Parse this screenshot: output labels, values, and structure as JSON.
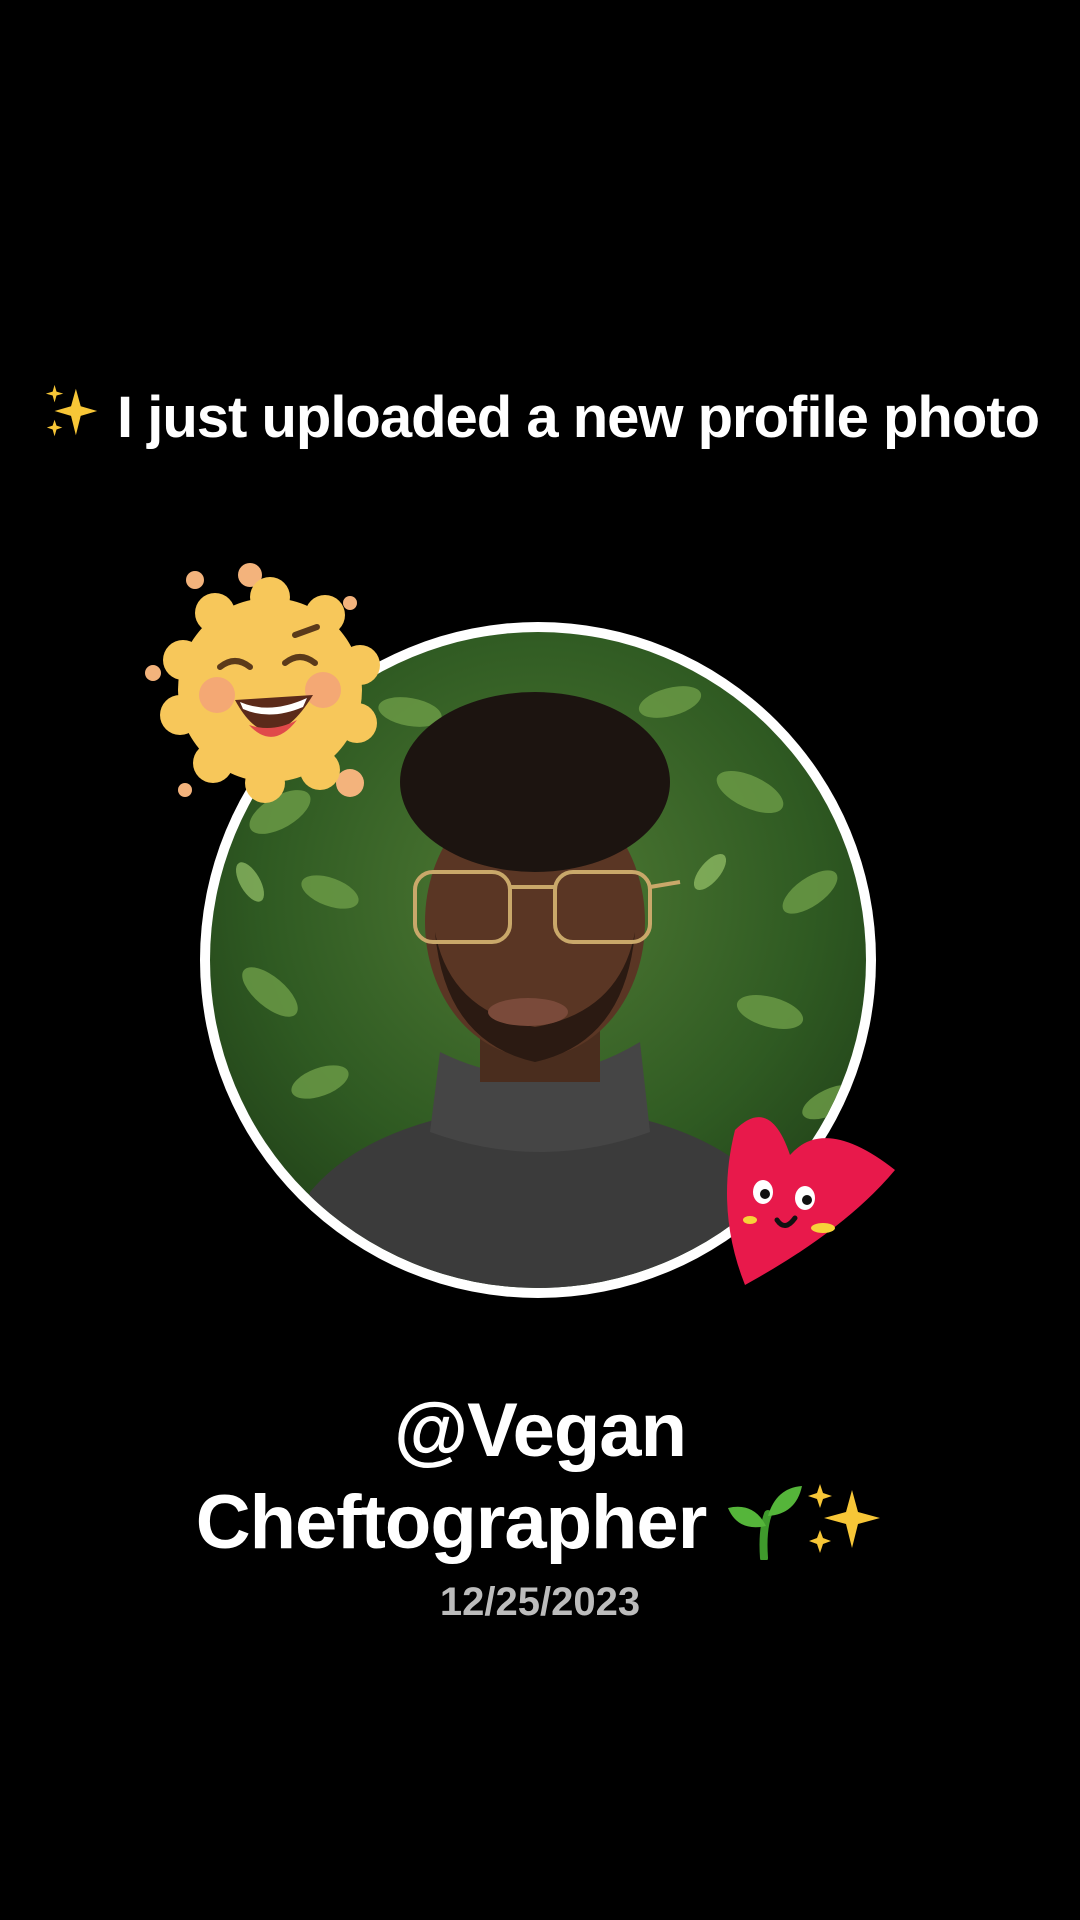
{
  "post": {
    "announcement": "I just uploaded a new profile photo",
    "username_line1": "@Vegan",
    "username_line2": "Cheftographer",
    "date": "12/25/2023"
  },
  "stickers": {
    "top_left": "laughing-sun-icon",
    "bottom_right": "smiling-heart-icon",
    "emoji_before_announcement": "sparkles-icon",
    "emoji_after_username": [
      "seedling-icon",
      "sparkles-icon"
    ]
  },
  "colors": {
    "background": "#000000",
    "text": "#ffffff",
    "date_text": "#bcbcbc",
    "photo_ring": "#ffffff",
    "sun": "#f7c75a",
    "heart": "#e8194b",
    "sparkle": "#f7c637"
  }
}
